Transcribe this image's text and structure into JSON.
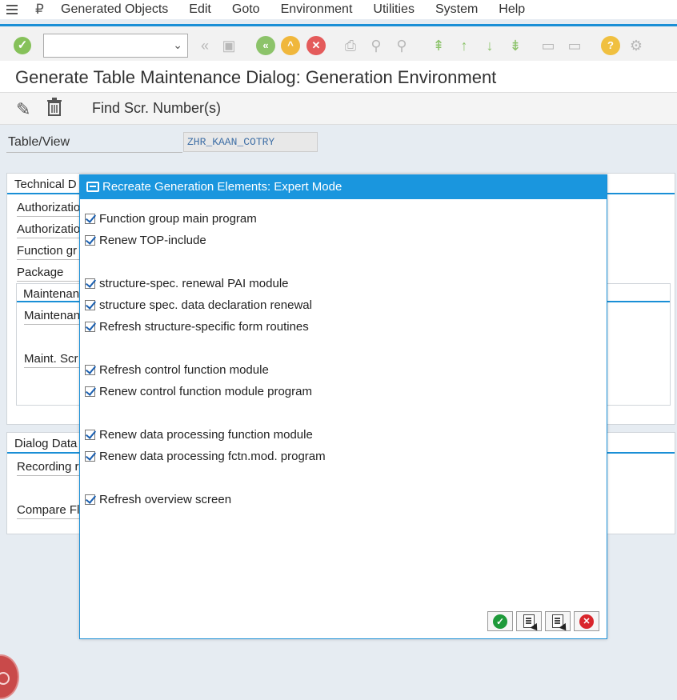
{
  "menubar": {
    "items": [
      "Generated Objects",
      "Edit",
      "Goto",
      "Environment",
      "Utilities",
      "System",
      "Help"
    ]
  },
  "toolbar": {
    "command_value": "",
    "icons": [
      "enter-icon",
      "back-icon",
      "save-icon",
      "back-green-icon",
      "up-icon",
      "cancel-icon",
      "print-icon",
      "find-icon",
      "find-next-icon",
      "first-page-icon",
      "prev-page-icon",
      "next-page-icon",
      "last-page-icon",
      "new-session-icon",
      "shortcut-icon",
      "help-icon",
      "settings-icon"
    ]
  },
  "page": {
    "title": "Generate Table Maintenance Dialog: Generation Environment"
  },
  "app_toolbar": {
    "find_label": "Find Scr. Number(s)"
  },
  "main": {
    "table_view_label": "Table/View",
    "table_view_value": "ZHR_KAAN_COTRY",
    "technical_group": {
      "title": "Technical D",
      "labels": [
        "Authorizatio",
        "Authorizatio",
        "Function gr",
        "Package"
      ],
      "sub_title": "Maintenan",
      "sub_labels": [
        "Maintenan",
        "Maint. Scr"
      ]
    },
    "dialog_group": {
      "title": "Dialog Data",
      "labels": [
        "Recording r",
        "Compare Fl"
      ]
    }
  },
  "dialog": {
    "title": "Recreate Generation Elements: Expert Mode",
    "options": [
      {
        "label": "Function group main program",
        "checked": true
      },
      {
        "label": "Renew TOP-include",
        "checked": true
      },
      {
        "label": "structure-spec. renewal PAI module",
        "checked": true
      },
      {
        "label": "structure spec. data declaration renewal",
        "checked": true
      },
      {
        "label": "Refresh structure-specific form routines",
        "checked": true
      },
      {
        "label": "Refresh control function module",
        "checked": true
      },
      {
        "label": "Renew control function module program",
        "checked": true
      },
      {
        "label": "Renew data processing function module",
        "checked": true
      },
      {
        "label": "Renew data processing fctn.mod. program",
        "checked": true
      },
      {
        "label": "Refresh overview screen",
        "checked": true
      }
    ],
    "buttons": [
      "ok-icon",
      "select-all-icon",
      "deselect-all-icon",
      "cancel-icon"
    ]
  },
  "colors": {
    "accent": "#1a96de",
    "ok": "#1e9a3a",
    "cancel": "#d9262c",
    "checkmark": "#1a5fb0"
  }
}
